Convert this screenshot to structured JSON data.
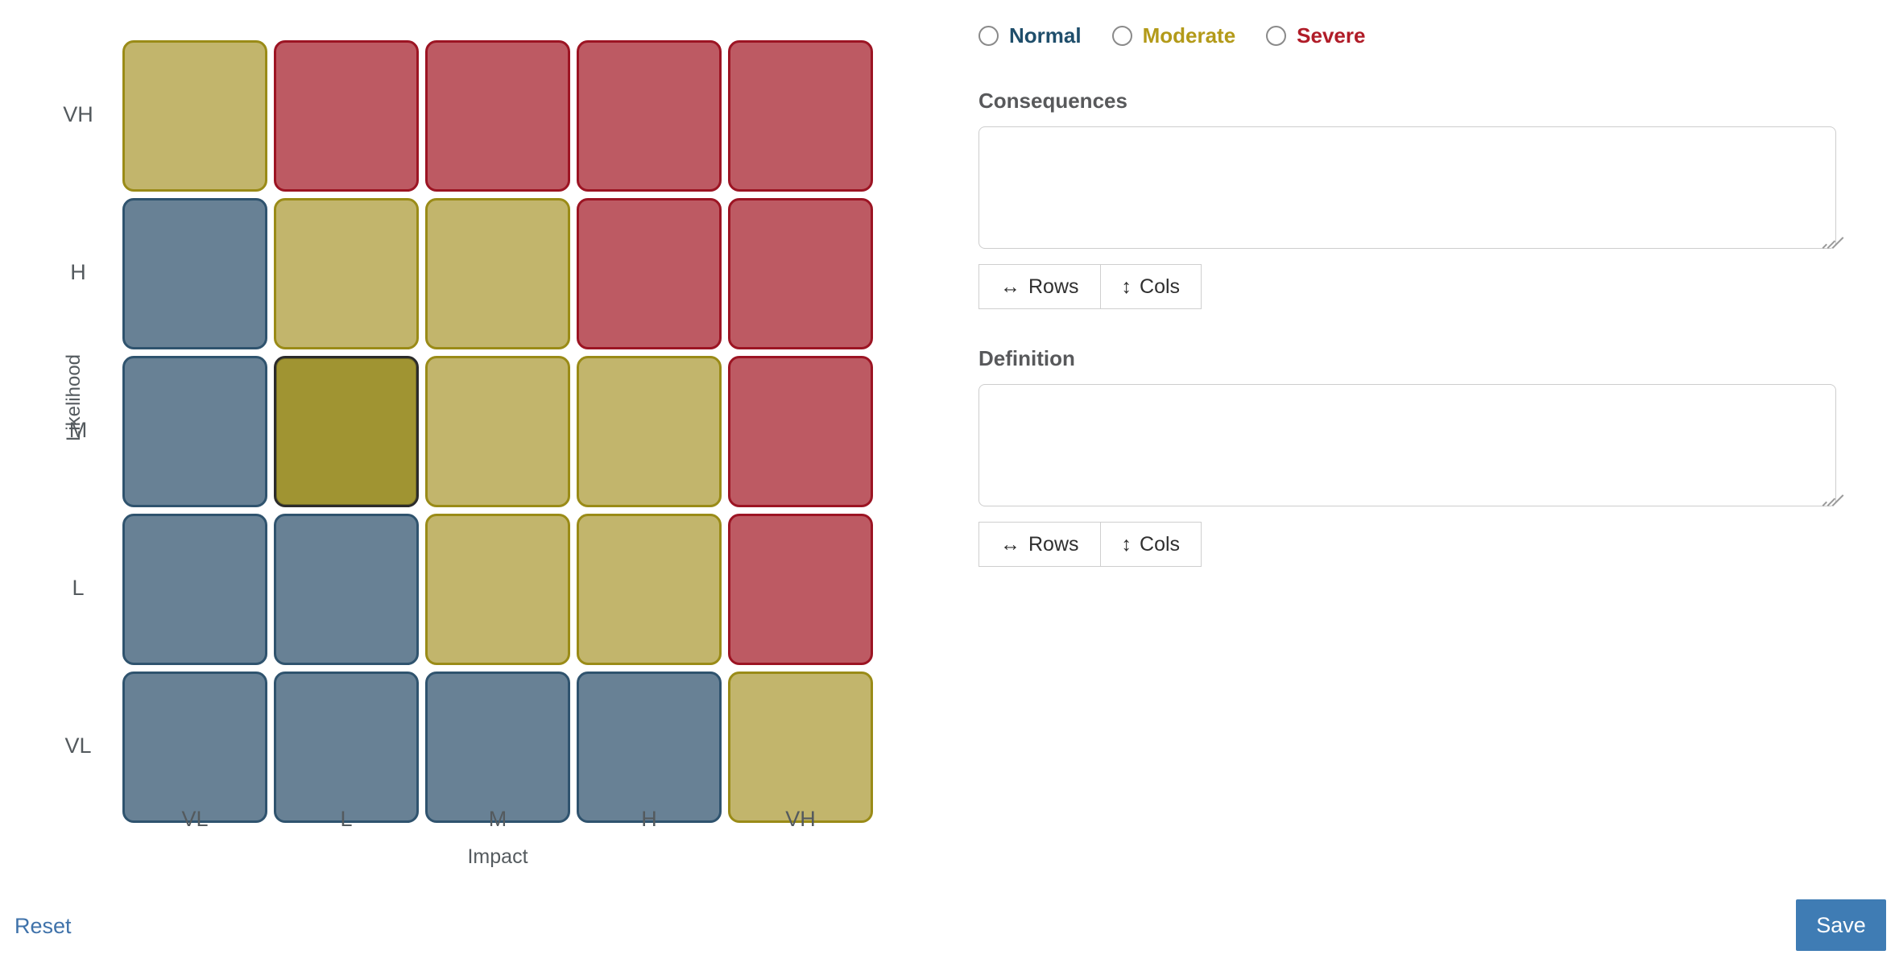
{
  "matrix": {
    "y_axis_title": "Likelihood",
    "x_axis_title": "Impact",
    "y_ticks": [
      "VH",
      "H",
      "M",
      "L",
      "VL"
    ],
    "x_ticks": [
      "VL",
      "L",
      "M",
      "H",
      "VH"
    ],
    "colors": {
      "blue": "#688195",
      "yellow": "#c2b56c",
      "red": "#bd5a63",
      "selected": "#a09432"
    },
    "selected_cell": {
      "likelihood": "M",
      "impact": "L"
    },
    "cells": [
      [
        "yellow",
        "red",
        "red",
        "red",
        "red"
      ],
      [
        "blue",
        "yellow",
        "yellow",
        "red",
        "red"
      ],
      [
        "blue",
        "selected",
        "yellow",
        "yellow",
        "red"
      ],
      [
        "blue",
        "blue",
        "yellow",
        "yellow",
        "red"
      ],
      [
        "blue",
        "blue",
        "blue",
        "blue",
        "yellow"
      ]
    ]
  },
  "severity": {
    "options": [
      {
        "label": "Normal",
        "color": "#1f4e6b",
        "selected": false
      },
      {
        "label": "Moderate",
        "color": "#b39a19",
        "selected": false
      },
      {
        "label": "Severe",
        "color": "#b01c28",
        "selected": false
      }
    ]
  },
  "consequences": {
    "title": "Consequences",
    "value": "",
    "placeholder": "",
    "rows_label": "Rows",
    "cols_label": "Cols",
    "rows_glyph": "↔",
    "cols_glyph": "↕"
  },
  "definition": {
    "title": "Definition",
    "value": "",
    "placeholder": "",
    "rows_label": "Rows",
    "cols_label": "Cols",
    "rows_glyph": "↔",
    "cols_glyph": "↕"
  },
  "footer": {
    "reset_label": "Reset",
    "save_label": "Save",
    "save_color": "#3f7cb4",
    "reset_color": "#3f72aa"
  }
}
